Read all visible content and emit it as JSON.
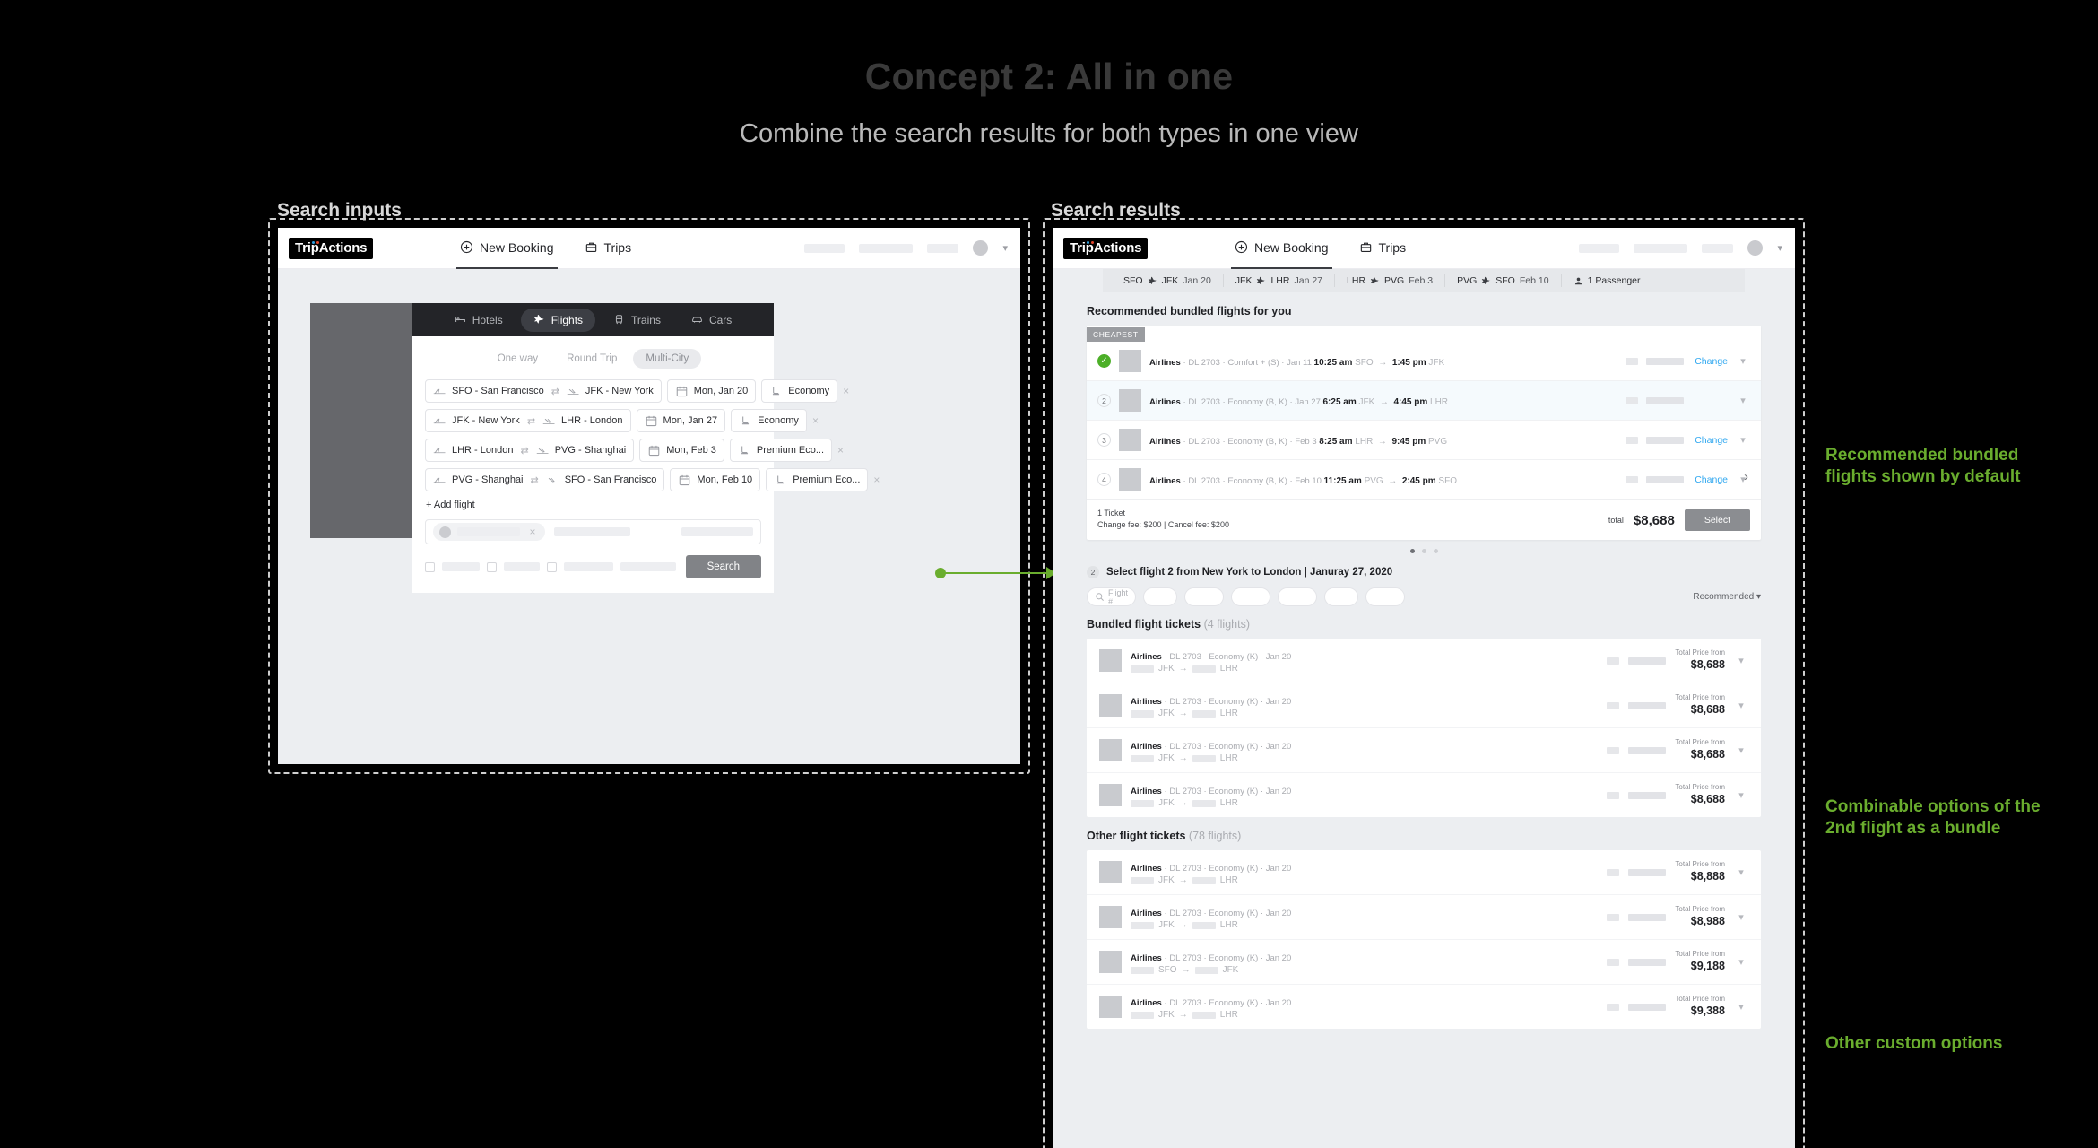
{
  "slide": {
    "title": "Concept 2: All in one",
    "subtitle": "Combine the search results for both types in one view",
    "label_left": "Search inputs",
    "label_right": "Search results"
  },
  "brand": {
    "logo": "TripActions"
  },
  "topnav": {
    "new_booking": "New Booking",
    "trips": "Trips"
  },
  "left_panel": {
    "modes": [
      {
        "label": "Hotels",
        "icon": "bed-icon",
        "active": false
      },
      {
        "label": "Flights",
        "icon": "plane-icon",
        "active": true
      },
      {
        "label": "Trains",
        "icon": "train-icon",
        "active": false
      },
      {
        "label": "Cars",
        "icon": "car-icon",
        "active": false
      }
    ],
    "trip_tabs": [
      {
        "label": "One way",
        "active": false
      },
      {
        "label": "Round Trip",
        "active": false
      },
      {
        "label": "Multi-City",
        "active": true
      }
    ],
    "flights": [
      {
        "from": "SFO - San Francisco",
        "to": "JFK - New York",
        "date": "Mon, Jan 20",
        "cabin": "Economy"
      },
      {
        "from": "JFK - New York",
        "to": "LHR - London",
        "date": "Mon, Jan 27",
        "cabin": "Economy"
      },
      {
        "from": "LHR - London",
        "to": "PVG - Shanghai",
        "date": "Mon, Feb 3",
        "cabin": "Premium Eco..."
      },
      {
        "from": "PVG - Shanghai",
        "to": "SFO - San Francisco",
        "date": "Mon, Feb 10",
        "cabin": "Premium Eco..."
      }
    ],
    "add_flight": "+ Add flight",
    "search_button": "Search"
  },
  "right_panel": {
    "criteria": [
      {
        "from": "SFO",
        "to": "JFK",
        "date": "Jan 20"
      },
      {
        "from": "JFK",
        "to": "LHR",
        "date": "Jan 27"
      },
      {
        "from": "LHR",
        "to": "PVG",
        "date": "Feb 3"
      },
      {
        "from": "PVG",
        "to": "SFO",
        "date": "Feb 10"
      }
    ],
    "passengers": "1 Passenger",
    "recommended_title": "Recommended bundled flights for you",
    "bundle": {
      "tag": "CHEAPEST",
      "legs": [
        {
          "index": "1",
          "selected": true,
          "airline": "Airlines",
          "flight_no": "DL 2703",
          "cabin": "Comfort + (S)",
          "date": "Jan 11",
          "dep_time": "10:25 am",
          "dep_code": "SFO",
          "arr_time": "1:45 pm",
          "arr_code": "JFK",
          "change": "Change"
        },
        {
          "index": "2",
          "selected": false,
          "airline": "Airlines",
          "flight_no": "DL 2703",
          "cabin": "Economy (B, K)",
          "date": "Jan 27",
          "dep_time": "6:25 am",
          "dep_code": "JFK",
          "arr_time": "4:45 pm",
          "arr_code": "LHR",
          "change": ""
        },
        {
          "index": "3",
          "selected": false,
          "airline": "Airlines",
          "flight_no": "DL 2703",
          "cabin": "Economy (B, K)",
          "date": "Feb 3",
          "dep_time": "8:25 am",
          "dep_code": "LHR",
          "arr_time": "9:45 pm",
          "arr_code": "PVG",
          "change": "Change"
        },
        {
          "index": "4",
          "selected": false,
          "airline": "Airlines",
          "flight_no": "DL 2703",
          "cabin": "Economy (B, K)",
          "date": "Feb 10",
          "dep_time": "11:25 am",
          "dep_code": "PVG",
          "arr_time": "2:45 pm",
          "arr_code": "SFO",
          "change": "Change"
        }
      ],
      "ticket_count": "1 Ticket",
      "fees": "Change fee: $200 | Cancel fee: $200",
      "total_label": "total",
      "total_price": "$8,688",
      "select_button": "Select"
    },
    "step2": {
      "number": "2",
      "title": "Select flight 2 from New York to London | Januray 27, 2020",
      "search_placeholder": "Flight #",
      "sort_label": "Recommended"
    },
    "bundled_section": {
      "title": "Bundled flight tickets",
      "count": "(4 flights)",
      "rows": [
        {
          "airline": "Airlines",
          "flight_no": "DL 2703",
          "cabin": "Economy (K)",
          "date": "Jan 20",
          "from": "JFK",
          "to": "LHR",
          "price_label": "Total Price from",
          "price": "$8,688"
        },
        {
          "airline": "Airlines",
          "flight_no": "DL 2703",
          "cabin": "Economy (K)",
          "date": "Jan 20",
          "from": "JFK",
          "to": "LHR",
          "price_label": "Total Price from",
          "price": "$8,688"
        },
        {
          "airline": "Airlines",
          "flight_no": "DL 2703",
          "cabin": "Economy (K)",
          "date": "Jan 20",
          "from": "JFK",
          "to": "LHR",
          "price_label": "Total Price from",
          "price": "$8,688"
        },
        {
          "airline": "Airlines",
          "flight_no": "DL 2703",
          "cabin": "Economy (K)",
          "date": "Jan 20",
          "from": "JFK",
          "to": "LHR",
          "price_label": "Total Price from",
          "price": "$8,688"
        }
      ]
    },
    "other_section": {
      "title": "Other flight tickets",
      "count": "(78 flights)",
      "rows": [
        {
          "airline": "Airlines",
          "flight_no": "DL 2703",
          "cabin": "Economy (K)",
          "date": "Jan 20",
          "from": "JFK",
          "to": "LHR",
          "price_label": "Total Price from",
          "price": "$8,888"
        },
        {
          "airline": "Airlines",
          "flight_no": "DL 2703",
          "cabin": "Economy (K)",
          "date": "Jan 20",
          "from": "JFK",
          "to": "LHR",
          "price_label": "Total Price from",
          "price": "$8,988"
        },
        {
          "airline": "Airlines",
          "flight_no": "DL 2703",
          "cabin": "Economy (K)",
          "date": "Jan 20",
          "from": "SFO",
          "to": "JFK",
          "price_label": "Total Price from",
          "price": "$9,188"
        },
        {
          "airline": "Airlines",
          "flight_no": "DL 2703",
          "cabin": "Economy (K)",
          "date": "Jan 20",
          "from": "JFK",
          "to": "LHR",
          "price_label": "Total Price from",
          "price": "$9,388"
        }
      ]
    },
    "carousel_dots": 3,
    "carousel_active": 0
  },
  "annotations": [
    "Recommended bundled\nflights shown by default",
    "Combinable options of the\n2nd flight as a bundle",
    "Other custom options"
  ],
  "colors": {
    "accent_green": "#6aad2e",
    "link_blue": "#31a8f0",
    "selected_green": "#4caf28",
    "panel_bg": "#eceef1"
  }
}
